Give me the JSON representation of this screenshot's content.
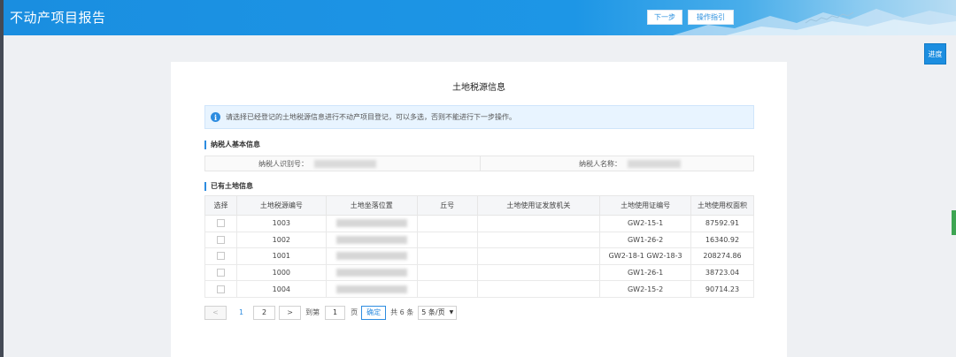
{
  "header": {
    "title": "不动产项目报告",
    "next_label": "下一步",
    "guide_label": "操作指引"
  },
  "progress_label": "进度",
  "card": {
    "title": "土地税源信息",
    "notice": "请选择已经登记的土地税源信息进行不动产项目登记，可以多选，否则不能进行下一步操作。"
  },
  "basic_section": {
    "title": "纳税人基本信息",
    "taxpayer_id_label": "纳税人识别号：",
    "taxpayer_name_label": "纳税人名称："
  },
  "land_section": {
    "title": "已有土地信息",
    "columns": [
      "选择",
      "土地税源编号",
      "土地坐落位置",
      "丘号",
      "土地使用证发放机关",
      "土地使用证编号",
      "土地使用权面积"
    ],
    "rows": [
      {
        "id": "1003",
        "cert": "GW2-15-1",
        "area": "87592.91"
      },
      {
        "id": "1002",
        "cert": "GW1-26-2",
        "area": "16340.92"
      },
      {
        "id": "1001",
        "cert": "GW2-18-1 GW2-18-3",
        "area": "208274.86"
      },
      {
        "id": "1000",
        "cert": "GW1-26-1",
        "area": "38723.04"
      },
      {
        "id": "1004",
        "cert": "GW2-15-2",
        "area": "90714.23"
      }
    ]
  },
  "pager": {
    "prev": "<",
    "page1": "1",
    "page2": "2",
    "next": ">",
    "goto_label": "到第",
    "goto_value": "1",
    "page_unit": "页",
    "ok": "确定",
    "total": "共 6 条",
    "size": "5 条/页",
    "size_arrow": "▼"
  },
  "colors": {
    "accent": "#2d8ce0",
    "header": "#1d96e6"
  }
}
